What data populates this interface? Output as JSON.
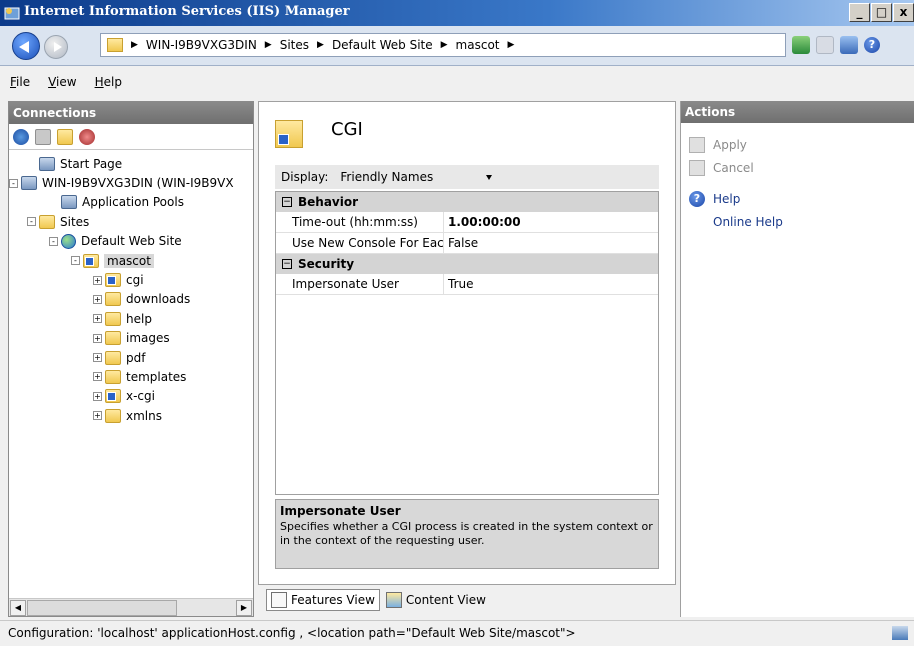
{
  "window": {
    "title": "Internet Information Services (IIS) Manager",
    "controls": [
      "_",
      "□",
      "x"
    ]
  },
  "address": {
    "crumbs": [
      "WIN-I9B9VXG3DIN",
      "Sites",
      "Default Web Site",
      "mascot"
    ]
  },
  "menu": [
    "File",
    "View",
    "Help"
  ],
  "connections": {
    "title": "Connections",
    "tree": [
      {
        "label": "Start Page",
        "icon": "start-page-icon",
        "indent": 1
      },
      {
        "label": "WIN-I9B9VXG3DIN (WIN-I9B9VX",
        "icon": "server-icon",
        "indent": 0,
        "expander": "-"
      },
      {
        "label": "Application Pools",
        "icon": "app-pools-icon",
        "indent": 2
      },
      {
        "label": "Sites",
        "icon": "sites-icon",
        "indent": 1,
        "expander": "-"
      },
      {
        "label": "Default Web Site",
        "icon": "globe-icon",
        "indent": 2,
        "expander": "-"
      },
      {
        "label": "mascot",
        "icon": "app-folder-icon",
        "indent": 3,
        "expander": "-",
        "selected": true
      },
      {
        "label": "cgi",
        "icon": "app-folder-icon",
        "indent": 4,
        "expander": "+"
      },
      {
        "label": "downloads",
        "icon": "folder-icon",
        "indent": 4,
        "expander": "+"
      },
      {
        "label": "help",
        "icon": "folder-icon",
        "indent": 4,
        "expander": "+"
      },
      {
        "label": "images",
        "icon": "folder-icon",
        "indent": 4,
        "expander": "+"
      },
      {
        "label": "pdf",
        "icon": "folder-icon",
        "indent": 4,
        "expander": "+"
      },
      {
        "label": "templates",
        "icon": "folder-icon",
        "indent": 4,
        "expander": "+"
      },
      {
        "label": "x-cgi",
        "icon": "app-folder-icon",
        "indent": 4,
        "expander": "+"
      },
      {
        "label": "xmlns",
        "icon": "folder-icon",
        "indent": 4,
        "expander": "+"
      }
    ]
  },
  "feature": {
    "title": "CGI",
    "display_label": "Display:",
    "display_value": "Friendly Names",
    "categories": [
      {
        "name": "Behavior",
        "rows": [
          {
            "key": "Time-out (hh:mm:ss)",
            "value": "1.00:00:00",
            "bold": true
          },
          {
            "key": "Use New Console For Eac",
            "value": "False"
          }
        ]
      },
      {
        "name": "Security",
        "rows": [
          {
            "key": "Impersonate User",
            "value": "True"
          }
        ]
      }
    ],
    "description_title": "Impersonate User",
    "description_text": "Specifies whether a CGI process is created in the system context or in the context of the requesting user."
  },
  "views": {
    "features": "Features View",
    "content": "Content View"
  },
  "actions": {
    "title": "Actions",
    "apply": "Apply",
    "cancel": "Cancel",
    "help": "Help",
    "online_help": "Online Help"
  },
  "status": {
    "text": "Configuration: 'localhost' applicationHost.config , <location path=\"Default Web Site/mascot\">"
  }
}
